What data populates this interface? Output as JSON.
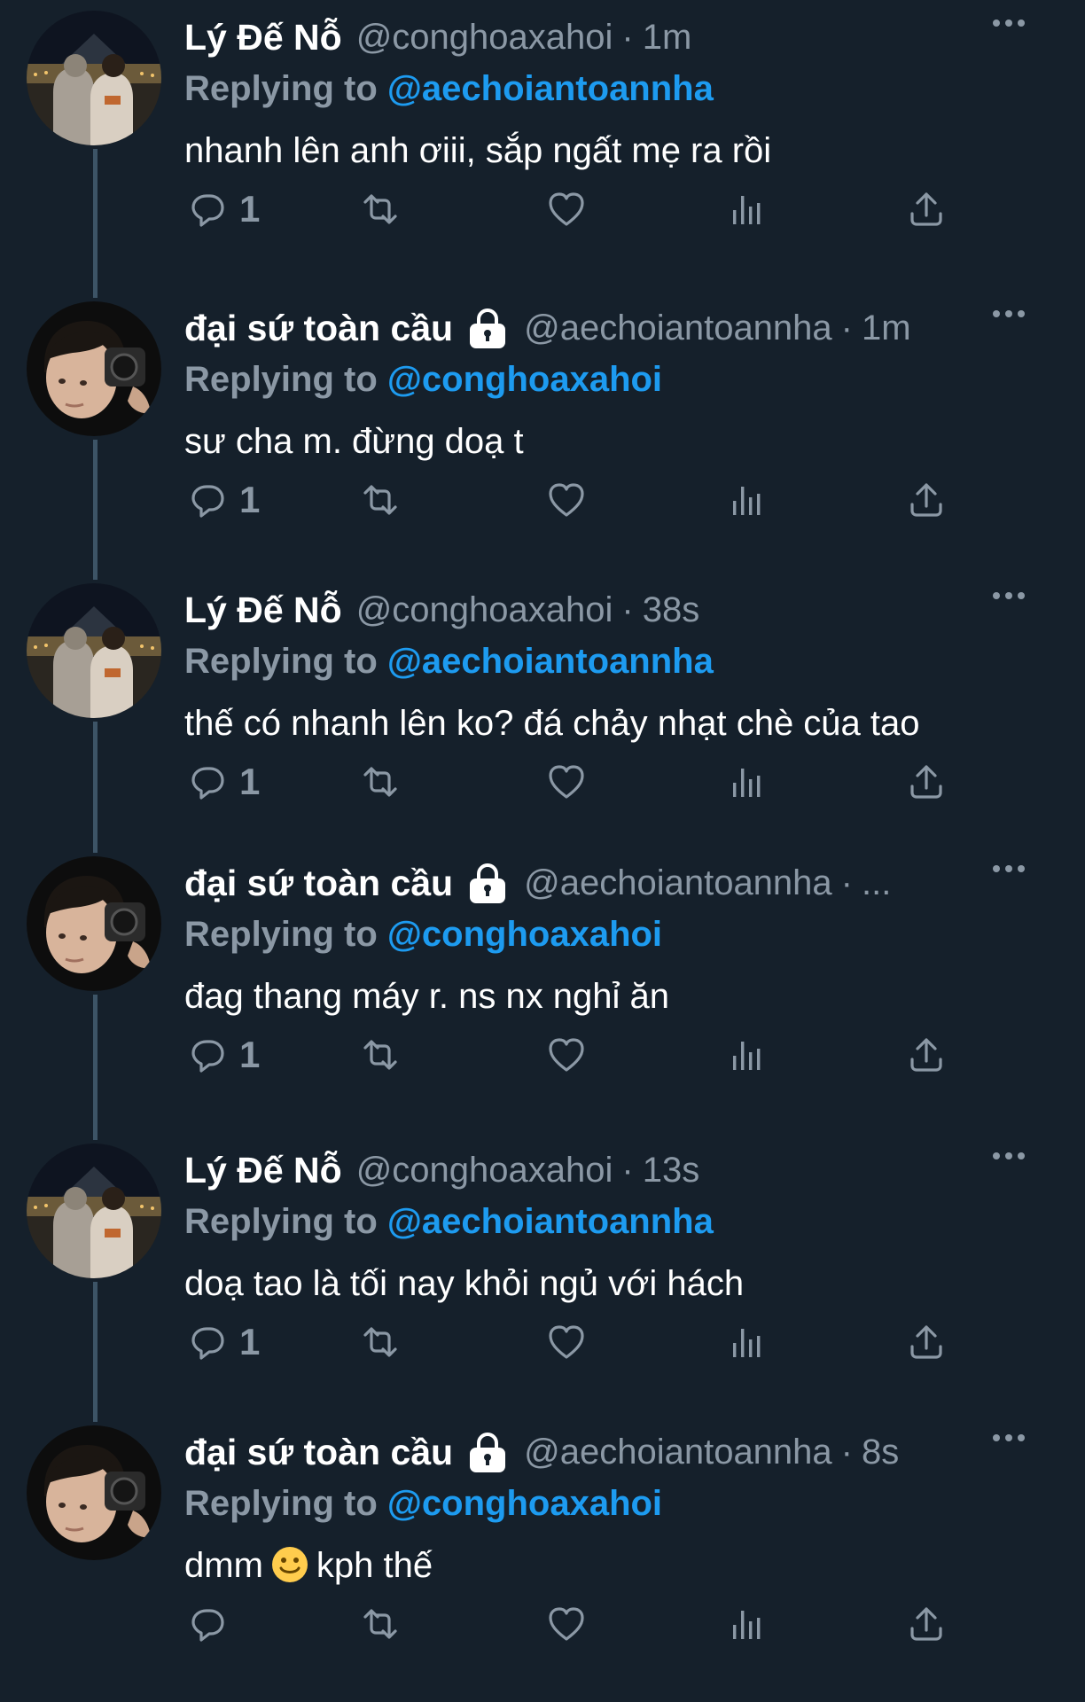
{
  "tweets": [
    {
      "author": "lyde",
      "name": "Lý Đế Nỗ",
      "handle": "@conghoaxahoi",
      "dot": "·",
      "time": "1m",
      "locked": false,
      "replying_label": "Replying to",
      "replying_to": "@aechoiantoannha",
      "text": "nhanh lên anh ơiii, sắp ngất mẹ ra rồi",
      "reply_count": "1"
    },
    {
      "author": "daisu",
      "name": "đại sứ toàn cầu",
      "handle": "@aechoiantoannha",
      "dot": "·",
      "time": "1m",
      "locked": true,
      "replying_label": "Replying to",
      "replying_to": "@conghoaxahoi",
      "text": "sư cha m. đừng doạ t",
      "reply_count": "1"
    },
    {
      "author": "lyde",
      "name": "Lý Đế Nỗ",
      "handle": "@conghoaxahoi",
      "dot": "·",
      "time": "38s",
      "locked": false,
      "replying_label": "Replying to",
      "replying_to": "@aechoiantoannha",
      "text": "thế có nhanh lên ko? đá chảy nhạt chè của tao",
      "reply_count": "1"
    },
    {
      "author": "daisu",
      "name": "đại sứ toàn cầu",
      "handle": "@aechoiantoannha",
      "dot": "·",
      "time": "...",
      "locked": true,
      "replying_label": "Replying to",
      "replying_to": "@conghoaxahoi",
      "text": "đag thang máy r. ns nx nghỉ ăn",
      "reply_count": "1"
    },
    {
      "author": "lyde",
      "name": "Lý Đế Nỗ",
      "handle": "@conghoaxahoi",
      "dot": "·",
      "time": "13s",
      "locked": false,
      "replying_label": "Replying to",
      "replying_to": "@aechoiantoannha",
      "text": "doạ tao là tối nay khỏi ngủ với hách",
      "reply_count": "1"
    },
    {
      "author": "daisu",
      "name": "đại sứ toàn cầu",
      "handle": "@aechoiantoannha",
      "dot": "·",
      "time": "8s",
      "locked": true,
      "replying_label": "Replying to",
      "replying_to": "@conghoaxahoi",
      "text_before": "dmm",
      "emoji": "slightly-smiling-face-emoji",
      "text_after": "kph thế",
      "reply_count": ""
    }
  ],
  "icons": {
    "reply": "reply-icon",
    "retweet": "retweet-icon",
    "like": "heart-icon",
    "views": "analytics-icon",
    "share": "share-icon",
    "more": "more-icon",
    "lock": "lock-icon"
  },
  "colors": {
    "background": "#15202b",
    "text": "#ffffff",
    "muted": "#8b98a5",
    "link": "#1d9bf0",
    "thread_line": "#3d5466"
  }
}
